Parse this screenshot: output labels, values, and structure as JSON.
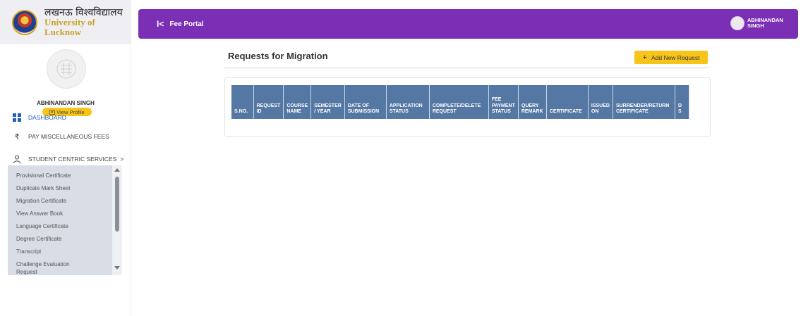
{
  "brand": {
    "hindi": "लखनऊ विश्वविद्यालय",
    "english": "University of Lucknow"
  },
  "user": {
    "name": "ABHINANDAN SINGH",
    "view_profile": "View Profile"
  },
  "nav": {
    "dashboard": "DASHBOARD",
    "pay_misc": "PAY MISCELLANEOUS FEES",
    "student_centric": "STUDENT CENTRIC SERVICES",
    "student_centric_chevron": ">"
  },
  "submenu": {
    "items": [
      "Provisional Certificate",
      "Duplicate Mark Sheet",
      "Migration Certificate",
      "View Answer Book",
      "Language Certificate",
      "Degree Certificate",
      "Transcript",
      "Challenge Evaluation",
      "Request"
    ]
  },
  "header": {
    "collapse": "I<",
    "title": "Fee Portal",
    "user_line1": "ABHINANDAN",
    "user_line2": "SINGH"
  },
  "main": {
    "title": "Requests for Migration",
    "add_button": "Add New Request",
    "add_plus": "+"
  },
  "table": {
    "columns": [
      [
        "S.NO."
      ],
      [
        "REQUEST",
        "ID"
      ],
      [
        "COURSE",
        "NAME"
      ],
      [
        "SEMESTER",
        "/ YEAR"
      ],
      [
        "DATE OF",
        "SUBMISSION"
      ],
      [
        "APPLICATION",
        "STATUS"
      ],
      [
        "COMPLETE/DELETE",
        "REQUEST"
      ],
      [
        "FEE",
        "PAYMENT",
        "STATUS"
      ],
      [
        "QUERY",
        "REMARK"
      ],
      [
        "CERTIFICATE"
      ],
      [
        "ISSUED",
        "ON"
      ],
      [
        "SURRENDER/RETURN",
        "CERTIFICATE"
      ],
      [
        "D",
        "S"
      ]
    ]
  },
  "colors": {
    "header_bg": "#7b2fb4",
    "accent_yellow": "#f7c51a",
    "table_header_bg": "#5477a3",
    "nav_active": "#1f5fbf",
    "submenu_bg": "#d8dde6"
  }
}
